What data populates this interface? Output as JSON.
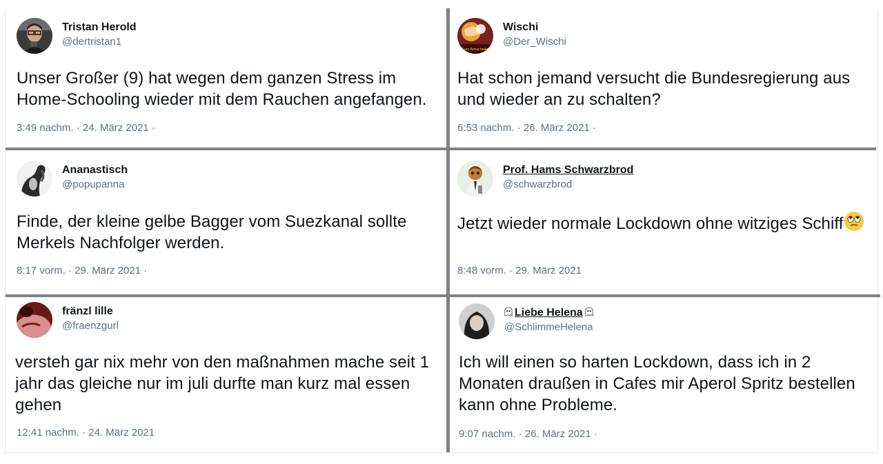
{
  "tweets": [
    {
      "name": "Tristan Herold",
      "handle": "@dertristan1",
      "lines": [
        "Unser Großer (9) hat wegen dem ganzen Stress im",
        "Home-Schooling wieder mit dem Rauchen angefangen."
      ],
      "meta": "3:49 nachm. · 24. März 2021 ·"
    },
    {
      "name": "Wischi",
      "handle": "@Der_Wischi",
      "avatar_text": "Euro Armut beitet",
      "lines": [
        "Hat schon jemand versucht die Bundesregierung aus",
        "und wieder an zu schalten?"
      ],
      "meta": "6:53 nachm. · 26. März 2021 ·"
    },
    {
      "name": "Ananastisch",
      "handle": "@popupanna",
      "lines": [
        "Finde, der kleine gelbe Bagger vom Suezkanal sollte",
        "Merkels Nachfolger werden."
      ],
      "meta": "8:17 vorm. · 29. März 2021 ·"
    },
    {
      "name": "Prof. Hams Schwarzbrod",
      "handle": "@schwarzbrod",
      "lines": [
        "Jetzt wieder normale Lockdown ohne witziges Schiff"
      ],
      "emoji": "face-with-rolling-eyes-icon",
      "meta": "8:48 vorm. · 29. März 2021"
    },
    {
      "name": "fränzl lille",
      "handle": "@fraenzgurl",
      "lines": [
        "versteh gar nix mehr von den maßnahmen mache seit 1",
        "jahr das gleiche nur im juli durfte man kurz mal essen",
        "gehen"
      ],
      "meta": "12:41 nachm. · 24. März 2021"
    },
    {
      "name": "Liebe Helena",
      "handle": "@SchlimmeHelena",
      "name_icons": "ghost-icon",
      "lines": [
        "Ich will einen so harten Lockdown, dass ich in 2",
        "Monaten draußen in Cafes mir Aperol Spritz bestellen",
        "kann ohne Probleme."
      ],
      "meta": "9:07 nachm. · 26. März 2021 ·"
    }
  ],
  "colors": {
    "text": "#0f1419",
    "secondary": "#5b7083",
    "divider": "#808080",
    "emoji": "#f7c948"
  }
}
